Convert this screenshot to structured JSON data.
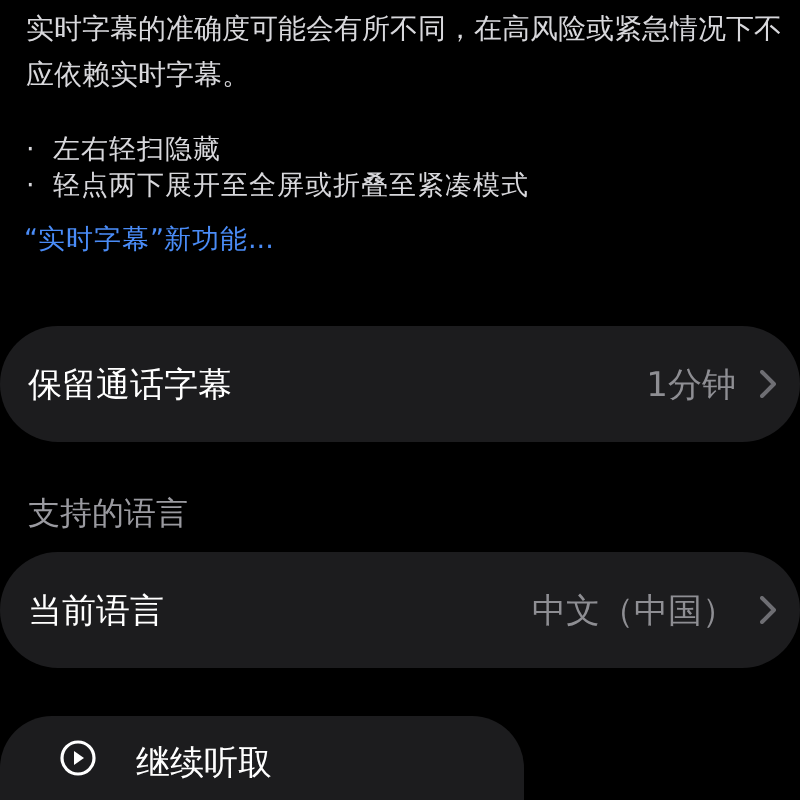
{
  "description": {
    "text": "实时字幕的准确度可能会有所不同，在高风险或紧急情况下不应依赖实时字幕。"
  },
  "tips": [
    {
      "bullet": "·",
      "text": "左右轻扫隐藏"
    },
    {
      "bullet": "·",
      "text": "轻点两下展开至全屏或折叠至紧凑模式"
    }
  ],
  "link": "“实时字幕”新功能...",
  "groups": [
    {
      "rows": [
        {
          "label": "保留通话字幕",
          "value": "1分钟"
        }
      ]
    },
    {
      "header": "支持的语言",
      "rows": [
        {
          "label": "当前语言",
          "value": "中文（中国）"
        }
      ]
    }
  ],
  "resume_button": {
    "label": "继续听取"
  }
}
